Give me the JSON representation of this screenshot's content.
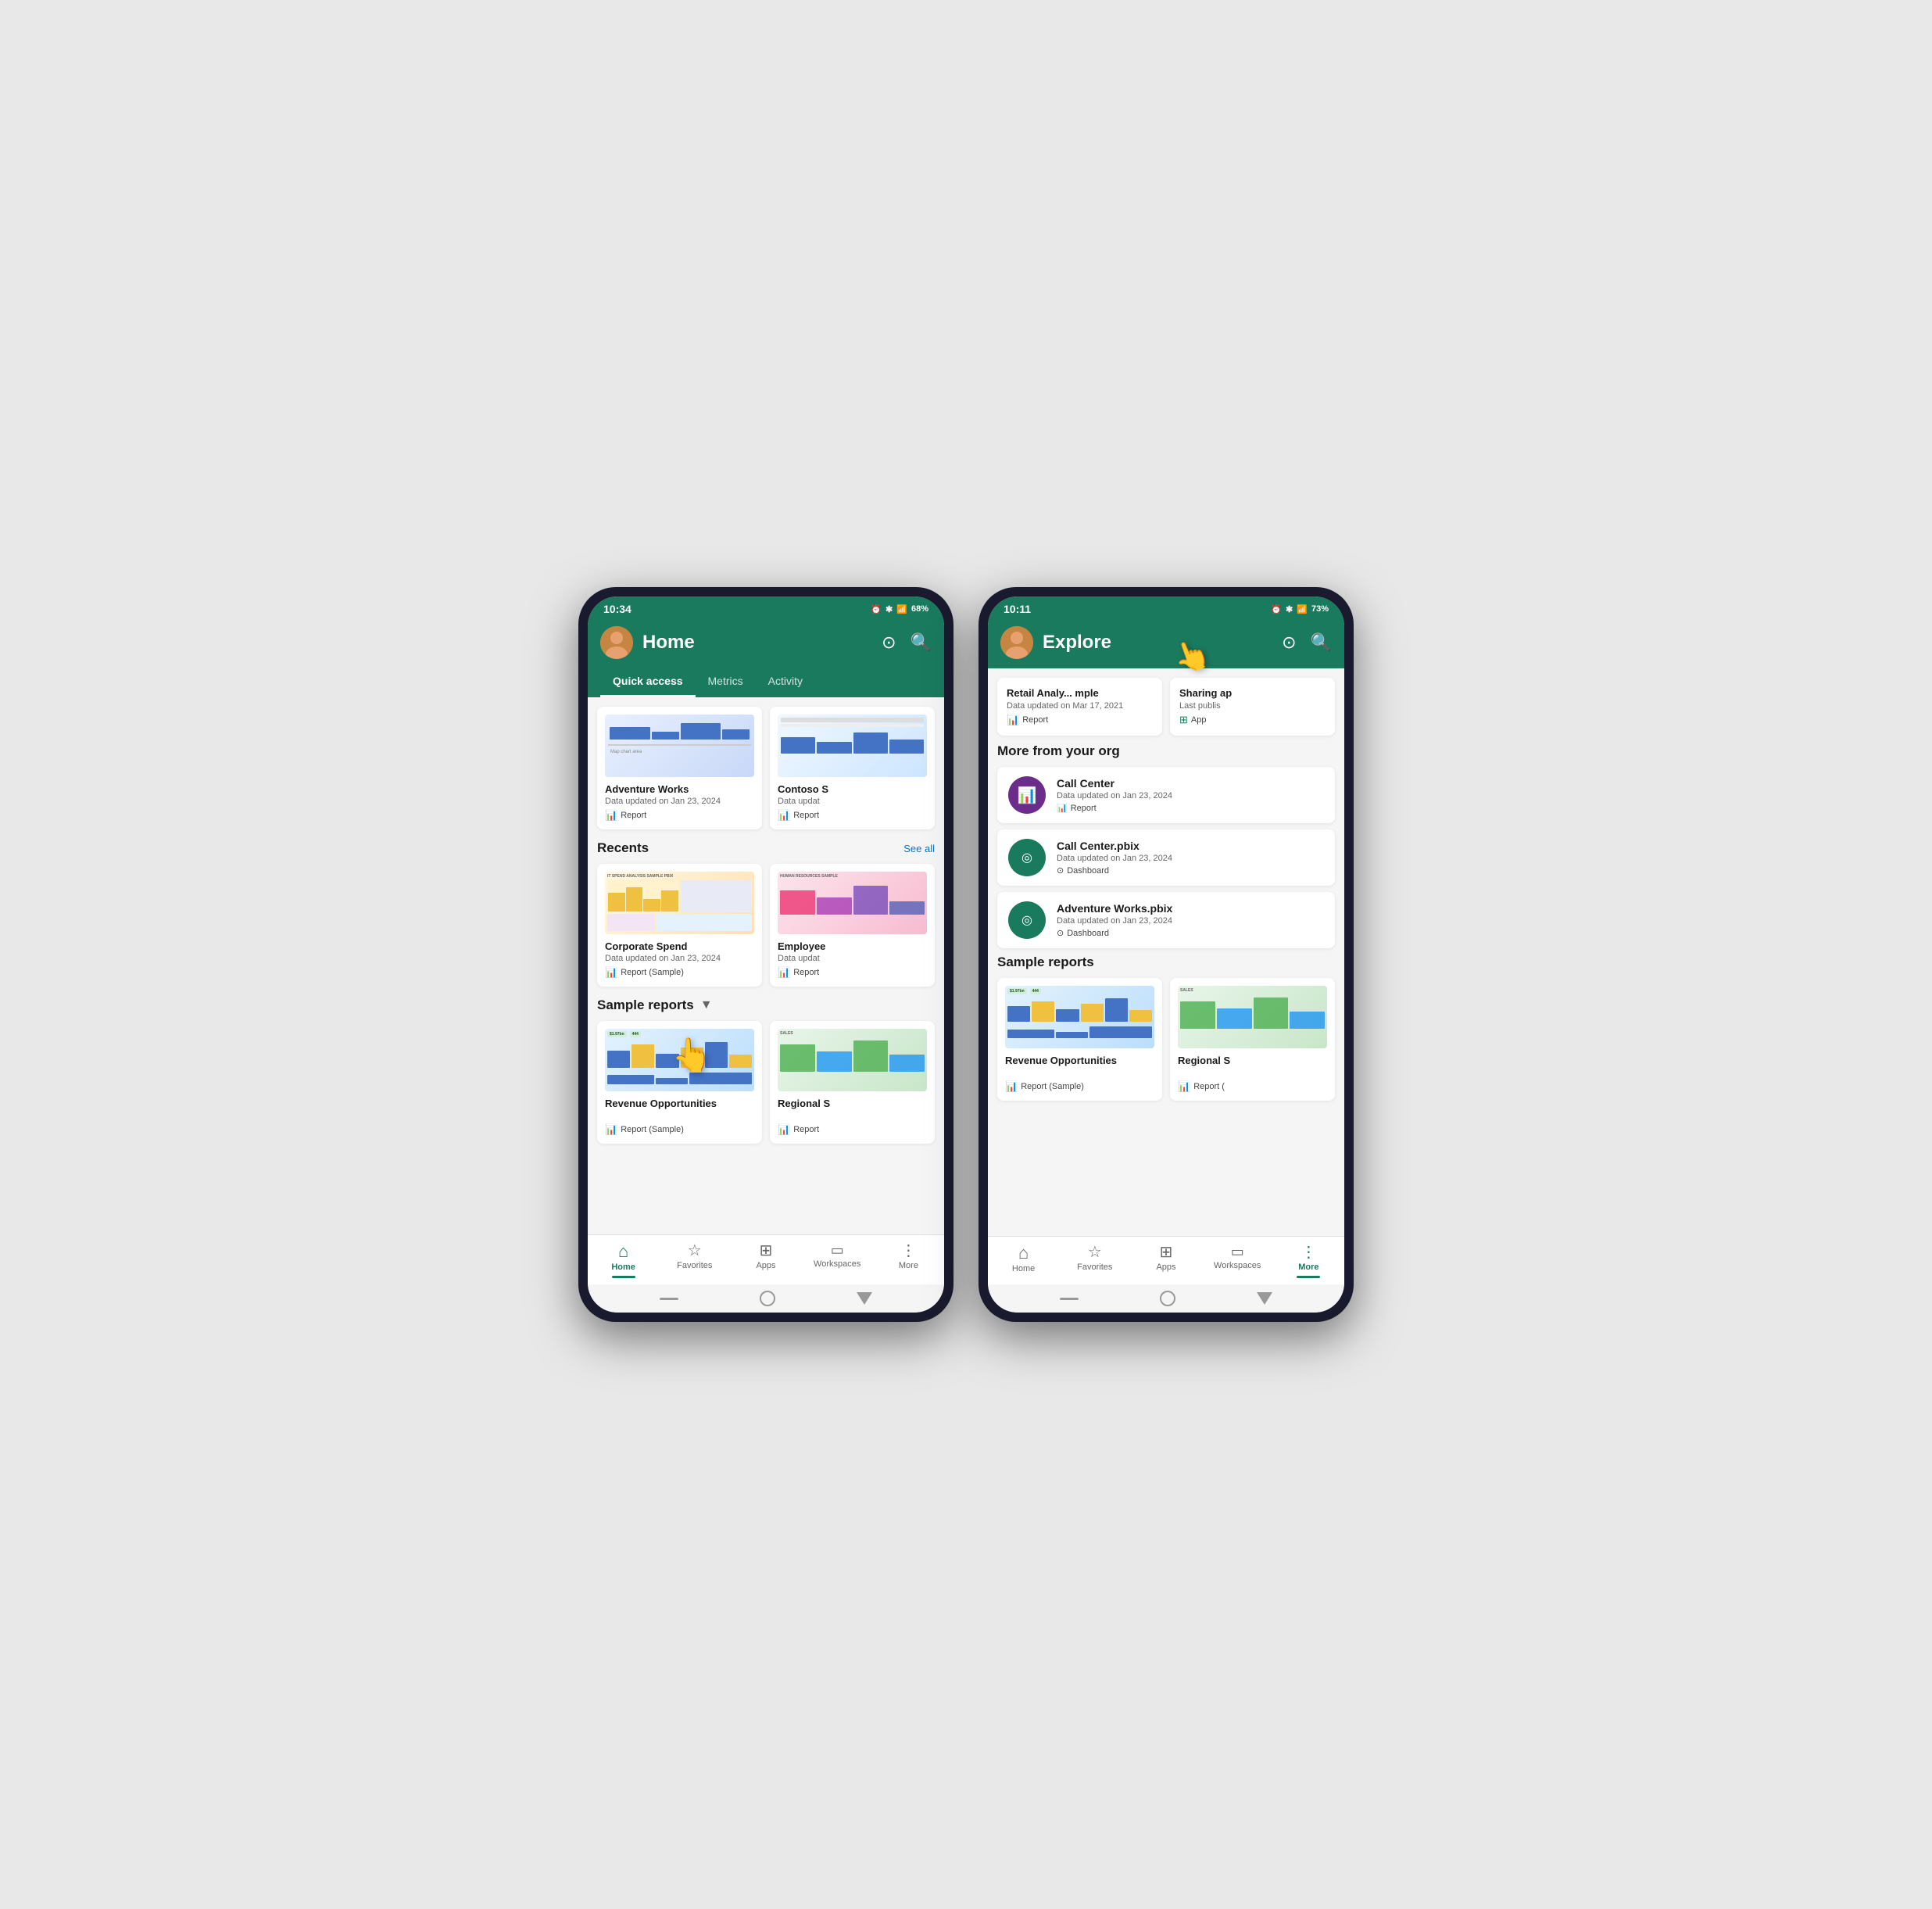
{
  "phone1": {
    "statusBar": {
      "time": "10:34",
      "battery": "68%",
      "signal": "VoLTE"
    },
    "header": {
      "title": "Home",
      "cameraIcon": "📷",
      "searchIcon": "🔍"
    },
    "tabs": [
      {
        "label": "Quick access",
        "active": true
      },
      {
        "label": "Metrics",
        "active": false
      },
      {
        "label": "Activity",
        "active": false
      }
    ],
    "quickAccessCards": [
      {
        "title": "Adventure Works",
        "date": "Data updated on Jan 23, 2024",
        "type": "Report"
      },
      {
        "title": "Contoso S",
        "date": "Data updat",
        "type": "Report"
      }
    ],
    "recents": {
      "sectionTitle": "Recents",
      "seeAll": "See all",
      "items": [
        {
          "title": "Corporate Spend",
          "date": "Data updated on Jan 23, 2024",
          "type": "Report (Sample)"
        },
        {
          "title": "Employee",
          "date": "Data updat",
          "type": "Report"
        }
      ]
    },
    "sampleReports": {
      "sectionTitle": "Sample reports",
      "items": [
        {
          "title": "Revenue Opportunities",
          "date": "",
          "type": "Report (Sample)"
        },
        {
          "title": "Regional S",
          "date": "",
          "type": "Report"
        }
      ]
    },
    "bottomNav": [
      {
        "icon": "🏠",
        "label": "Home",
        "active": true
      },
      {
        "icon": "☆",
        "label": "Favorites",
        "active": false
      },
      {
        "icon": "⊞",
        "label": "Apps",
        "active": false
      },
      {
        "icon": "▭",
        "label": "Workspaces",
        "active": false
      },
      {
        "icon": "⋮",
        "label": "More",
        "active": false
      }
    ]
  },
  "phone2": {
    "statusBar": {
      "time": "10:11",
      "battery": "73%",
      "signal": "VoLTE"
    },
    "header": {
      "title": "Explore",
      "cameraIcon": "📷",
      "searchIcon": "🔍"
    },
    "topCards": [
      {
        "title": "Retail Analy... mple",
        "date": "Data updated on Mar 17, 2021",
        "type": "Report"
      },
      {
        "title": "Sharing ap",
        "date": "Last publis",
        "type": "App"
      }
    ],
    "moreFromOrg": {
      "sectionTitle": "More from your org",
      "items": [
        {
          "title": "Call Center",
          "date": "Data updated on Jan 23, 2024",
          "type": "Report",
          "iconColor": "#6b2d8b",
          "iconText": "📊"
        },
        {
          "title": "Call Center.pbix",
          "date": "Data updated on Jan 23, 2024",
          "type": "Dashboard",
          "iconColor": "#1a7a5e",
          "iconText": "◎"
        },
        {
          "title": "Adventure Works.pbix",
          "date": "Data updated on Jan 23, 2024",
          "type": "Dashboard",
          "iconColor": "#1a7a5e",
          "iconText": "◎"
        }
      ]
    },
    "sampleReports": {
      "sectionTitle": "Sample reports",
      "items": [
        {
          "title": "Revenue Opportunities",
          "date": "",
          "type": "Report (Sample)"
        },
        {
          "title": "Regional S",
          "date": "",
          "type": "Report ("
        }
      ]
    },
    "bottomNav": [
      {
        "icon": "🏠",
        "label": "Home",
        "active": false
      },
      {
        "icon": "☆",
        "label": "Favorites",
        "active": false
      },
      {
        "icon": "⊞",
        "label": "Apps",
        "active": false
      },
      {
        "icon": "▭",
        "label": "Workspaces",
        "active": false
      },
      {
        "icon": "⋮",
        "label": "More",
        "active": true
      }
    ]
  }
}
